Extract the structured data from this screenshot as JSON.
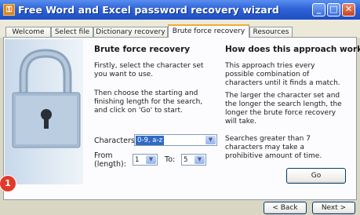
{
  "window": {
    "title": "Free Word and Excel password recovery wizard",
    "app_icon": "wizard-app-icon",
    "controls": {
      "minimize": "_",
      "maximize": "□",
      "close": "✕"
    }
  },
  "tabs": [
    {
      "label": "Welcome"
    },
    {
      "label": "Select file"
    },
    {
      "label": "Dictionary recovery"
    },
    {
      "label": "Brute force recovery",
      "active": true
    },
    {
      "label": "Resources"
    }
  ],
  "left": {
    "heading": "Brute force recovery",
    "para1": "Firstly, select the character set you want to use.",
    "para2": "Then choose the starting and finishing length for the search, and click on 'Go' to start.",
    "characters_label": "Characters",
    "characters_value": "0-9, a-z",
    "from_label_1": "From",
    "from_label_2": "(length):",
    "from_value": "1",
    "to_label": "To:",
    "to_value": "5"
  },
  "right": {
    "heading": "How does this approach work?",
    "para1": "This approach tries every possible combination of characters until it finds a match.",
    "para2": "The larger the character set and the longer the search length, the longer the brute force recovery will take.",
    "para3": "Searches greater than 7 characters may take a prohibitive amount of time.",
    "go_label": "Go"
  },
  "footer": {
    "back_label": "< Back",
    "next_label": "Next >"
  },
  "annotation": {
    "badge_number": "1"
  },
  "colors": {
    "titlebar": "#2f63d6",
    "active_tab_accent": "#f2a93b",
    "badge": "#e23a2a",
    "highlight": "#316ac5"
  }
}
